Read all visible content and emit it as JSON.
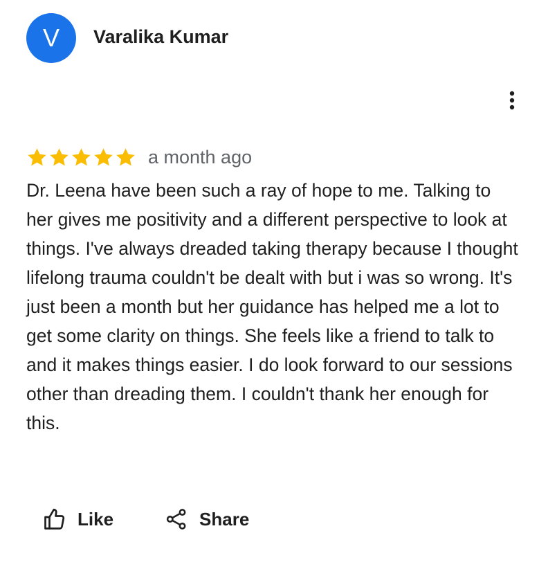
{
  "review": {
    "author": {
      "avatar_letter": "V",
      "avatar_color": "#1a73e8",
      "name": "Varalika Kumar"
    },
    "menu_icon": "more-vert-icon",
    "rating": {
      "stars": 5,
      "max_stars": 5,
      "star_color": "#fbbc04",
      "star_icon": "star-icon"
    },
    "timestamp": "a month ago",
    "text": "Dr. Leena have been such a ray of hope to me. Talking to her gives me positivity and a different perspective to look at things. I've always dreaded taking therapy because I thought lifelong trauma couldn't be dealt with but i was so wrong. It's just been a month but her guidance has helped me a lot to get some clarity on things. She feels like a friend to talk to and it makes things easier. I do look forward to our sessions other than dreading them. I couldn't thank her enough for this.",
    "actions": {
      "like": {
        "label": "Like",
        "icon": "thumbs-up-icon"
      },
      "share": {
        "label": "Share",
        "icon": "share-icon"
      }
    }
  }
}
